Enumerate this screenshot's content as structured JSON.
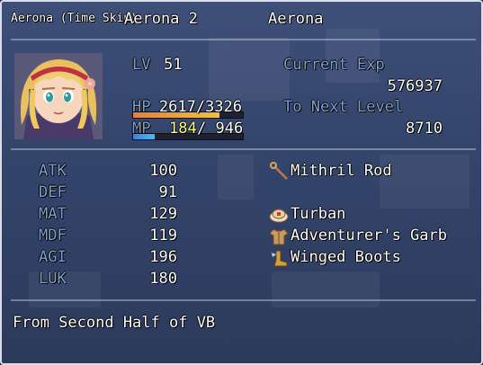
{
  "actor": {
    "name": "Aerona (Time Skip)",
    "nickname": "Aerona 2",
    "class_name": "Aerona",
    "level_label": "LV",
    "level": "51",
    "hp_label": "HP",
    "hp": "2617/3326",
    "hp_fraction": 0.787,
    "mp_label": "MP",
    "mp_current": "184",
    "mp_max": "/ 946",
    "mp_fraction": 0.195,
    "current_exp_label": "Current Exp",
    "current_exp": "576937",
    "next_level_label": "To Next Level",
    "next_level": "8710"
  },
  "params": [
    {
      "label": "ATK",
      "value": "100"
    },
    {
      "label": "DEF",
      "value": "91"
    },
    {
      "label": "MAT",
      "value": "129"
    },
    {
      "label": "MDF",
      "value": "119"
    },
    {
      "label": "AGI",
      "value": "196"
    },
    {
      "label": "LUK",
      "value": "180"
    }
  ],
  "equipment": [
    {
      "name": "Mithril Rod",
      "icon": "staff-icon"
    },
    {
      "name": "",
      "icon": ""
    },
    {
      "name": "Turban",
      "icon": "turban-icon"
    },
    {
      "name": "Adventurer's Garb",
      "icon": "garb-icon"
    },
    {
      "name": "Winged Boots",
      "icon": "boots-icon"
    }
  ],
  "profile": "From Second Half of VB",
  "colors": {
    "system_text": "#7fa0cc",
    "mp_low_text": "#ffff80",
    "hp_gauge": "#e08040",
    "mp_gauge": "#40a0e0"
  }
}
